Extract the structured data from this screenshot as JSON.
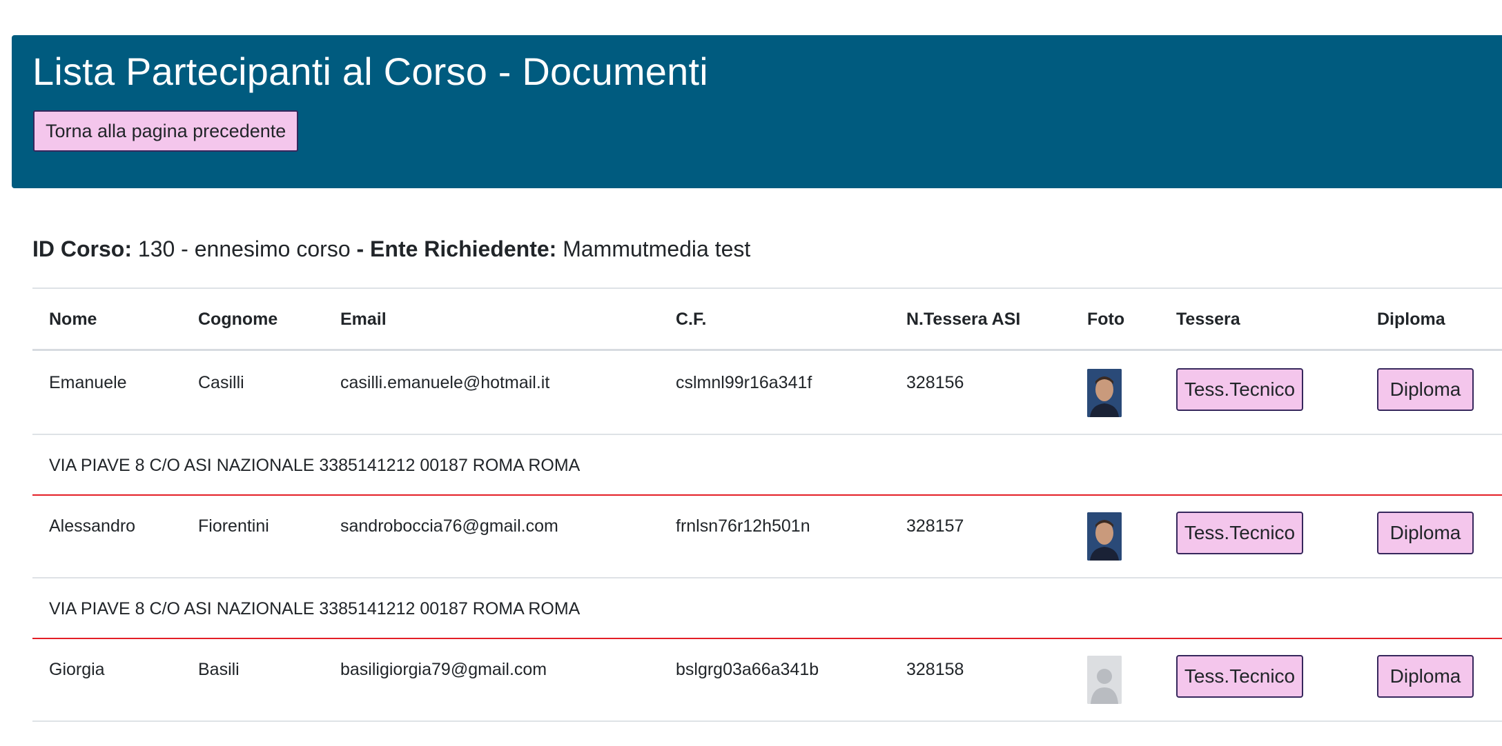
{
  "header": {
    "title": "Lista Partecipanti al Corso - Documenti",
    "back_label": "Torna alla pagina precedente"
  },
  "course": {
    "id_label": "ID Corso:",
    "id_value": "130 - ennesimo corso",
    "ente_label": "- Ente Richiedente:",
    "ente_value": "Mammutmedia test"
  },
  "table": {
    "headers": [
      "Nome",
      "Cognome",
      "Email",
      "C.F.",
      "N.Tessera ASI",
      "Foto",
      "Tessera",
      "Diploma"
    ],
    "rows": [
      {
        "nome": "Emanuele",
        "cognome": "Casilli",
        "email": "casilli.emanuele@hotmail.it",
        "cf": "cslmnl99r16a341f",
        "tessera_asi": "328156",
        "tessera_btn": "Tess.Tecnico",
        "diploma_btn": "Diploma",
        "address": "VIA PIAVE 8 C/O ASI NAZIONALE 3385141212 00187 ROMA ROMA"
      },
      {
        "nome": "Alessandro",
        "cognome": "Fiorentini",
        "email": "sandroboccia76@gmail.com",
        "cf": "frnlsn76r12h501n",
        "tessera_asi": "328157",
        "tessera_btn": "Tess.Tecnico",
        "diploma_btn": "Diploma",
        "address": "VIA PIAVE 8 C/O ASI NAZIONALE 3385141212 00187 ROMA ROMA"
      },
      {
        "nome": "Giorgia",
        "cognome": "Basili",
        "email": "basiligiorgia79@gmail.com",
        "cf": "bslgrg03a66a341b",
        "tessera_asi": "328158",
        "tessera_btn": "Tess.Tecnico",
        "diploma_btn": "Diploma"
      }
    ]
  }
}
